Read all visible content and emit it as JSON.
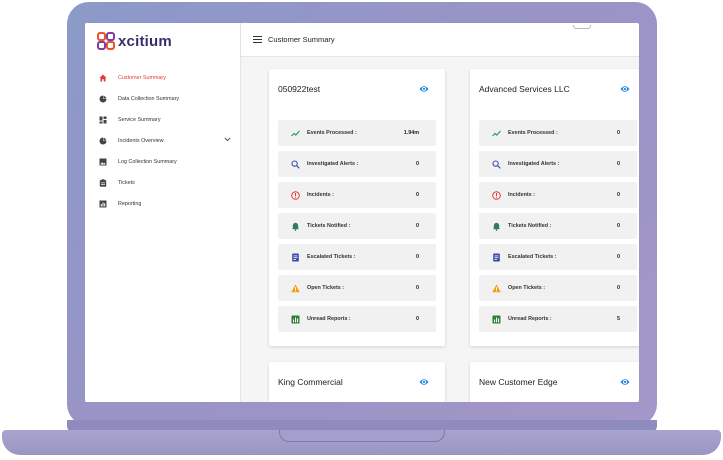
{
  "app": {
    "logo_text": "xcitium"
  },
  "sidebar": {
    "items": [
      {
        "label": "Customer Summary",
        "icon": "home-icon",
        "active": true
      },
      {
        "label": "Data Collection Summary",
        "icon": "pie-chart-icon"
      },
      {
        "label": "Service Summary",
        "icon": "dashboard-icon"
      },
      {
        "label": "Incidents Overview",
        "icon": "pie-chart-icon",
        "expandable": true
      },
      {
        "label": "Log Collection Summary",
        "icon": "image-icon"
      },
      {
        "label": "Tickets",
        "icon": "clipboard-icon"
      },
      {
        "label": "Reporting",
        "icon": "report-icon"
      }
    ]
  },
  "header": {
    "title": "Customer Summary"
  },
  "cards": [
    {
      "title": "050922test",
      "rows": [
        {
          "label": "Events Processed :",
          "value": "1.94m"
        },
        {
          "label": "Investigated Alerts :",
          "value": "0"
        },
        {
          "label": "Incidents :",
          "value": "0"
        },
        {
          "label": "Tickets Notified :",
          "value": "0"
        },
        {
          "label": "Escalated Tickets :",
          "value": "0"
        },
        {
          "label": "Open Tickets :",
          "value": "0"
        },
        {
          "label": "Unread Reports :",
          "value": "0"
        }
      ]
    },
    {
      "title": "Advanced Services LLC",
      "rows": [
        {
          "label": "Events Processed :",
          "value": "0"
        },
        {
          "label": "Investigated Alerts :",
          "value": "0"
        },
        {
          "label": "Incidents :",
          "value": "0"
        },
        {
          "label": "Tickets Notified :",
          "value": "0"
        },
        {
          "label": "Escalated Tickets :",
          "value": "0"
        },
        {
          "label": "Open Tickets :",
          "value": "0"
        },
        {
          "label": "Unread Reports :",
          "value": "5"
        }
      ]
    },
    {
      "title": "King Commercial"
    },
    {
      "title": "New Customer Edge"
    }
  ],
  "colors": {
    "accent_red": "#e53935",
    "eye_blue": "#1e88e5",
    "trend_green": "#2e9e4f",
    "search_blue": "#3f51b5",
    "alert_red": "#e53935",
    "bell_green": "#2e7d5b",
    "doc_blue": "#3949ab",
    "warn_orange": "#f59e0b",
    "report_green": "#2e7d32"
  }
}
